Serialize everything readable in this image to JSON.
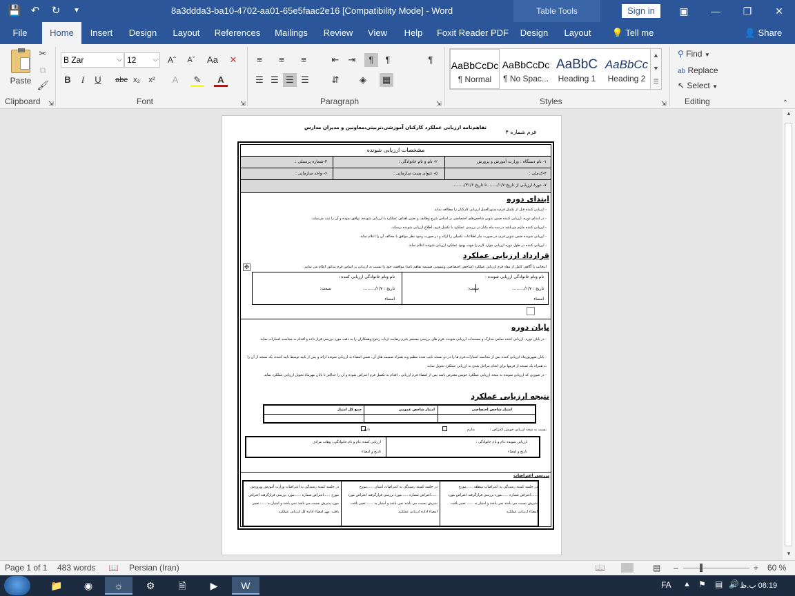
{
  "window": {
    "title": "8a3ddda3-ba10-4702-aa01-65e5faac2e16 [Compatibility Mode]  -  Word",
    "table_tools": "Table Tools",
    "sign_in": "Sign in",
    "quick_access": [
      "save-icon",
      "undo-icon",
      "redo-icon",
      "customize-icon"
    ]
  },
  "tabs": {
    "file": "File",
    "home": "Home",
    "insert": "Insert",
    "design": "Design",
    "layout": "Layout",
    "references": "References",
    "mailings": "Mailings",
    "review": "Review",
    "view": "View",
    "help": "Help",
    "foxit": "Foxit Reader PDF",
    "tt_design": "Design",
    "tt_layout": "Layout",
    "tell_me": "Tell me",
    "share": "Share"
  },
  "ribbon": {
    "clipboard": {
      "paste": "Paste",
      "label": "Clipboard"
    },
    "font": {
      "name": "B Zar",
      "size": "12",
      "label": "Font"
    },
    "paragraph": {
      "label": "Paragraph"
    },
    "styles": {
      "label": "Styles",
      "items": [
        {
          "sample": "AaBbCcDc",
          "name": "¶ Normal"
        },
        {
          "sample": "AaBbCcDc",
          "name": "¶ No Spac..."
        },
        {
          "sample": "AaBbC",
          "name": "Heading 1"
        },
        {
          "sample": "AaBbCc",
          "name": "Heading 2"
        }
      ]
    },
    "editing": {
      "label": "Editing",
      "find": "Find",
      "replace": "Replace",
      "select": "Select"
    }
  },
  "doc": {
    "form_number": "فرم شماره ۴",
    "main_title": "تفاهم‌نامه ارزیابی عملکرد کارکنان آموزشی،تربیتی،معاونین و مدیران مدارس",
    "section1_title": "مشخصات ارزیابی شونده",
    "field1": "۱- نام دستگاه : وزارت آموزش و پرورش",
    "field2": "۲- نام و نام خانوادگی :",
    "field3": "۳-شماره پرسنلی :",
    "field4": "۴-کدملی :",
    "field5": "۵- عنوان پست سازمانی :",
    "field6": "۶- واحد سازمانی :",
    "field7": "۷- دورهٔ ارزیابی از تاریخ ۱/۷/.......   تا تاریخ ۳۱/۶/.........",
    "start_title": "ابتدای دوره",
    "start_items": [
      "- ارزیابی کننده قبل از تکمیل فرم،دستورالعمل ارزیابی کارکنان را مطالعه نماید.",
      "- در ابتدای دوره، ارزیابی کننده ضمن تدوین شاخص‌های اختصاصی بر اساس شرح وظایف و تعیین اهداف عملکرد با ارزیابی شونده، توافق نموده و آن را ثبت می‌نماید.",
      "- ارزیابی کننده ملزم می‌باشد در سه ماه یکبار در بررسی عملکرد با تکمیل فرم، اطلاع ارزیابی شونده برساند.",
      "- ارزیابی شونده ضمن تدوین فرم، در صورت نیاز اطلاعات تکمیلی را ارائه و در صورت وجود نظر موافق یا مخالف آن را اعلام نماید.",
      "- ارزیابی کننده در طول دوره ارزیابی موارد لازم را جهت بهبود عملکرد ارزیابی شونده اعلام نماید."
    ],
    "contract_title": "قرارداد ارزیابی عملکرد",
    "contract_text": "اینجانب با آگاهی کامل از مفاد فرم ارزیابی عملکرد (شاخص اختصاصی وعمومی ضمیمه تفاهم نامه) موافقت خود را نسبت به ارزیابی بر اساس فرم مذکور اعلام می نمایم .",
    "assessee_name": "نام ونام خانوادگی ارزیابی شونده :",
    "assessor_name": "نام ونام خانوادگی ارزیابی کننده :",
    "date_label": "تاریخ :   ۱/۷/.........",
    "position_label": "سمت:",
    "signature": "امضاء",
    "end_title": "پایان دوره",
    "end_items": [
      "- در پایان دوره، ارزیابی کننده تمامی مدارک و مستندات ارزیابی شونده ،فرم های بررسی مستمر ،فرم رضایت ارباب رجوع وهمکاران را به دقت مورد بررسی قرار داده و اقدام به محاسبه امتیازات نماید.",
      "- پایان شهریورماه ارزیابی کننده پس از محاسبه امتیازات،فرم ها را در دو نسخه تایپ شده تنظیم وبه همراه ضمیمه های آن، ضمن امضاء به ارزیابی شونده ارائه و پس از تایید توسط تایید کننده، یک نسخه از آن را به همراه یک نسخه از فرمها برای انجام مراحل بعدی به ارزیابی عملکرد تحویل نماید.",
      "- در صورتی که ارزیابی شونده به نتیجه ارزیابی عملکرد خویش معترض باشد پس از امضاء فرم ارزیابی ، اقدام به تکمیل فرم اعتراض نموده و آن را حداکثر تا پایان مهرماه تحویل ارزیابی عملکرد نماید."
    ],
    "result_title": "نتیجه ارزیابی عملکرد",
    "score_headers": [
      "امتیاز شاخص اختصاصی",
      "امتیاز شاخص عمومی",
      "جمع کل امتیاز"
    ],
    "objection_line": "نسبت به نتیجه ارزیابی خویش اعتراض :",
    "objection_no": "ندارم",
    "objection_yes": "دارم",
    "assessee_sign": "ارزیابی شونده :نام و نام خانوادگی :",
    "assessor_sign": "ارزیابی کننده :نام و نام خانوادگی : وهاب مرادی",
    "date_sign": "تاریخ و امضاء",
    "review_title": "بررسی اعتراضات",
    "review_cols": [
      "در جلسه کمیته رسیدگی به اعتراضات منطقه ......مورخ ......اعتراض شماره ......مورد بررسی قرارگرفته اعتراض مورد پذیرش نسبت می باشد   نمی باشد و امتیاز به ...... تغییر یافت. امضاء ارزیابی عملکرد",
      "در جلسه کمیته رسیدگی به اعتراضات استان ......مورخ ......اعتراض شماره ......مورد بررسی قرارگرفته اعتراض مورد پذیرش نسبت می باشد   نمی باشد و امتیاز به ...... تغییر یافت. امضاء اداره ارزیابی عملکرد",
      "در جلسه کمیته رسیدگی به اعتراضات وزارت آموزش وپرورش مورخ ......اعتراض شماره ......مورد بررسی قرارگرفته اعتراض مورد پذیرش نسبت می باشد   نمی باشد و امتیاز به ...... تغییر یافت. مهر امضاء اداره کل ارزیابی عملکرد"
    ]
  },
  "status": {
    "page": "Page 1 of 1",
    "words": "483 words",
    "language": "Persian (Iran)",
    "zoom": "60 %"
  },
  "taskbar": {
    "lang": "FA",
    "time": "08:19 ب.ظ"
  }
}
